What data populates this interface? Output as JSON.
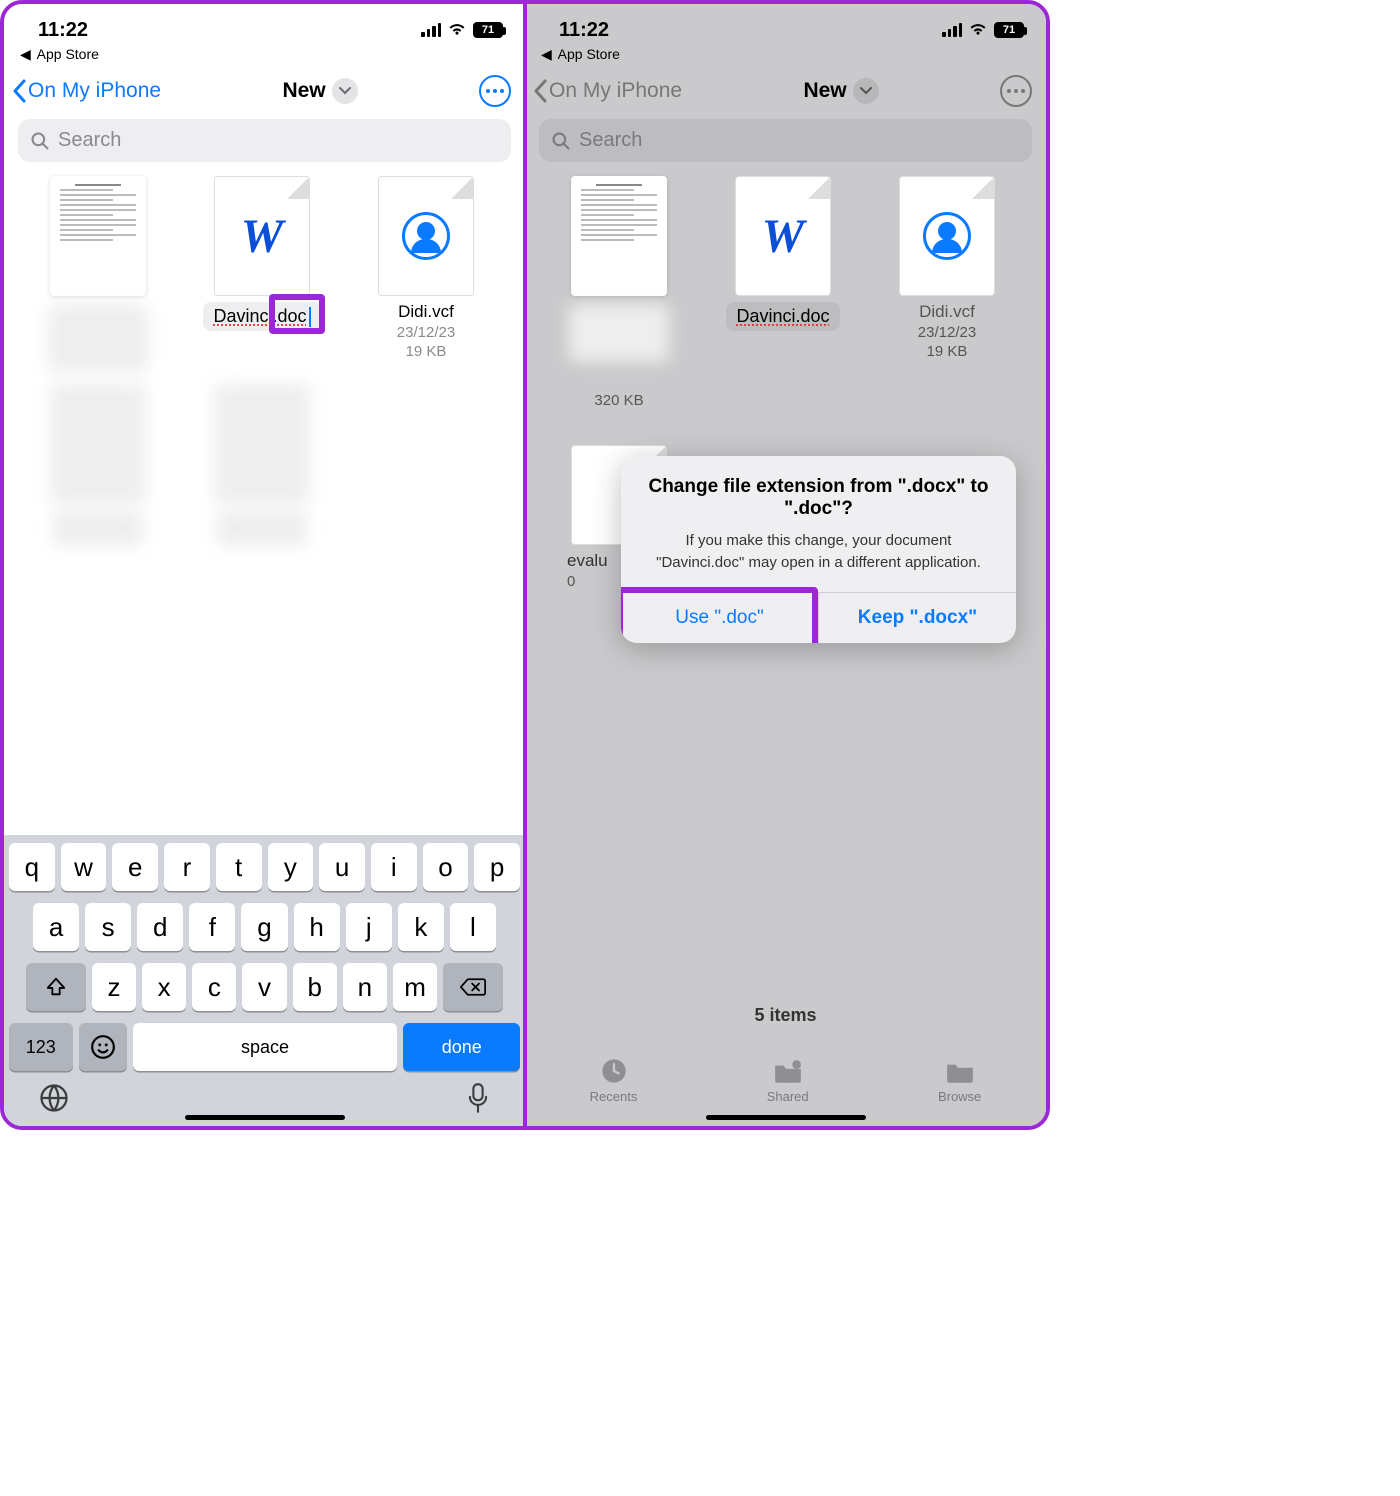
{
  "status": {
    "time": "11:22",
    "battery_pct": "71"
  },
  "breadcrumb": {
    "back_target": "App Store"
  },
  "nav": {
    "back_label": "On My iPhone",
    "title": "New"
  },
  "search": {
    "placeholder": "Search"
  },
  "left": {
    "rename_value": "Davinci.doc",
    "files": [
      {
        "name": "Didi.vcf",
        "date": "23/12/23",
        "size": "19 KB"
      }
    ],
    "keyboard": {
      "row1": [
        "q",
        "w",
        "e",
        "r",
        "t",
        "y",
        "u",
        "i",
        "o",
        "p"
      ],
      "row2": [
        "a",
        "s",
        "d",
        "f",
        "g",
        "h",
        "j",
        "k",
        "l"
      ],
      "row3": [
        "z",
        "x",
        "c",
        "v",
        "b",
        "n",
        "m"
      ],
      "num": "123",
      "space": "space",
      "done": "done"
    }
  },
  "right": {
    "files": [
      {
        "name": "Davinci.doc"
      },
      {
        "name": "Didi.vcf",
        "date": "23/12/23",
        "size": "19 KB"
      }
    ],
    "file0_size": "320 KB",
    "peek_filename_partial": "evalu",
    "peek_meta_partial": "0",
    "alert": {
      "title": "Change file extension from \".docx\" to \".doc\"?",
      "message": "If you make this change, your document \"Davinci.doc\" may open in a different application.",
      "confirm": "Use \".doc\"",
      "cancel": "Keep \".docx\""
    },
    "items_count": "5 items",
    "tabs": {
      "recents": "Recents",
      "shared": "Shared",
      "browse": "Browse"
    }
  }
}
